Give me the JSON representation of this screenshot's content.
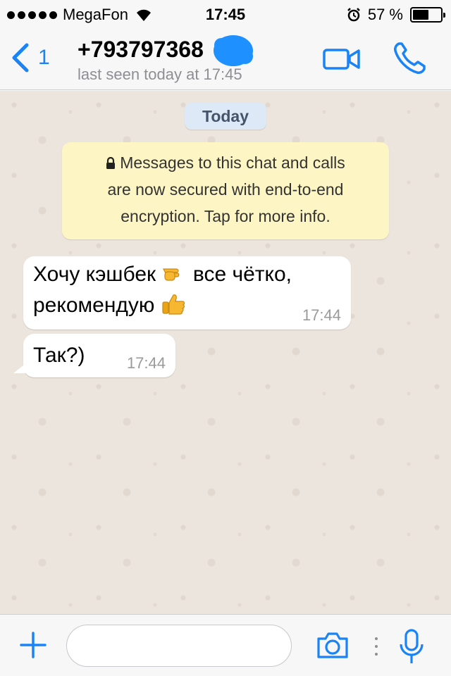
{
  "status_bar": {
    "carrier": "MegaFon",
    "time": "17:45",
    "battery_percent_text": "57 %",
    "battery_level": 0.57
  },
  "header": {
    "back_count": "1",
    "contact_name": "+793797368",
    "last_seen": "last seen today at 17:45"
  },
  "chat": {
    "date_label": "Today",
    "system_message_lines": [
      "Messages to this chat and calls",
      "are now secured with end-to-end",
      "encryption. Tap for more info."
    ],
    "messages": [
      {
        "line1_a": "Хочу кэшбек",
        "line1_b": "все чётко,",
        "line2": "рекомендую",
        "time": "17:44"
      },
      {
        "text": "Так?)",
        "time": "17:44"
      }
    ]
  },
  "input_bar": {
    "placeholder": ""
  },
  "icons": {
    "back": "chevron-left-icon",
    "video": "video-camera-icon",
    "call": "phone-icon",
    "plus": "plus-icon",
    "camera": "camera-icon",
    "mic": "microphone-icon"
  },
  "colors": {
    "accent": "#1a83f5",
    "chat_background": "#ece5dd",
    "system_bubble": "#fdf5c4",
    "date_pill": "#dde9f7"
  }
}
